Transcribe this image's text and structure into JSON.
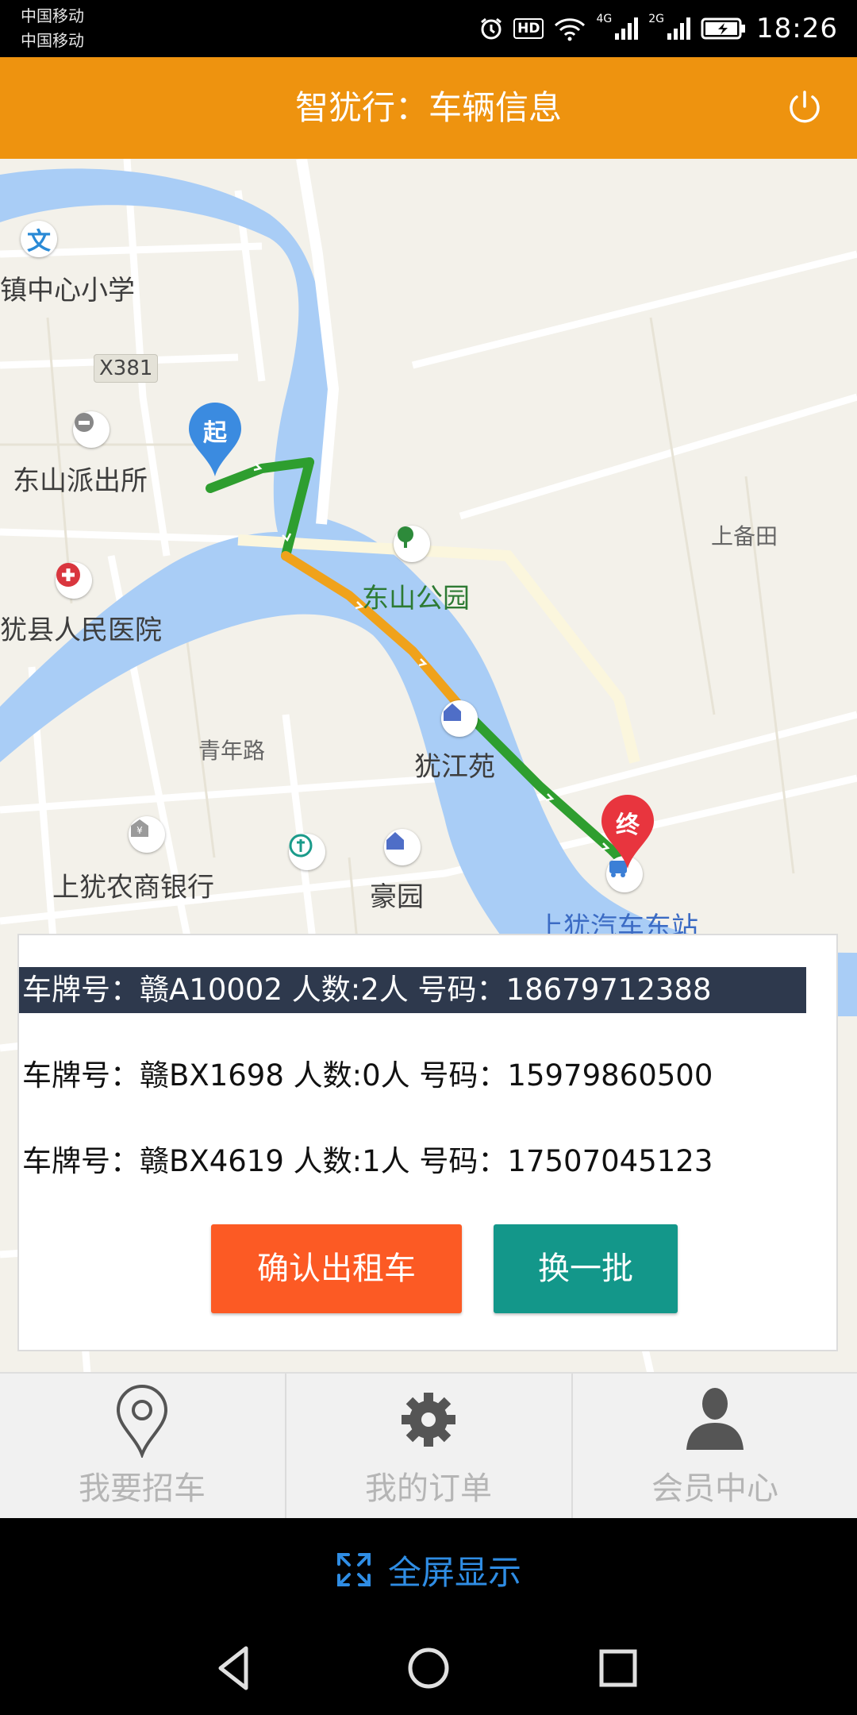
{
  "status_bar": {
    "carrier_1": "中国移动",
    "carrier_2": "中国移动",
    "hd": "HD",
    "sig1_label": "4G",
    "sig2_label": "2G",
    "time": "18:26"
  },
  "header": {
    "title": "智犹行：车辆信息",
    "power_icon": "power-icon"
  },
  "map": {
    "labels": {
      "school": "镇中心小学",
      "road_code": "X381",
      "police": "东山派出所",
      "shangbeitian": "上备田",
      "park": "东山公园",
      "hospital": "犹县人民医院",
      "youjiangyuan": "犹江苑",
      "qingnian_road": "青年路",
      "bank": "上犹农商银行",
      "haoyuan": "豪园",
      "bus_station": "上犹汽车东站"
    },
    "start_marker": "起",
    "end_marker": "终",
    "route_colors": {
      "clear": "#2e9e2f",
      "slow": "#f0a21b"
    }
  },
  "vehicles": {
    "rows": [
      {
        "text": "车牌号：赣A10002 人数:2人 号码：18679712388",
        "selected": true
      },
      {
        "text": "车牌号：赣BX1698 人数:0人 号码：15979860500",
        "selected": false
      },
      {
        "text": "车牌号：赣BX4619 人数:1人 号码：17507045123",
        "selected": false
      }
    ],
    "confirm_label": "确认出租车",
    "swap_label": "换一批"
  },
  "tabs": [
    {
      "label": "我要招车",
      "icon": "location-pin-icon"
    },
    {
      "label": "我的订单",
      "icon": "gear-icon"
    },
    {
      "label": "会员中心",
      "icon": "user-icon"
    }
  ],
  "fullscreen": {
    "label": "全屏显示",
    "icon": "expand-icon"
  },
  "colors": {
    "header": "#ee930f",
    "confirm": "#fc5a24",
    "swap": "#13978a",
    "selected_row": "#2e394d",
    "fullscreen_text": "#2f8de4"
  }
}
